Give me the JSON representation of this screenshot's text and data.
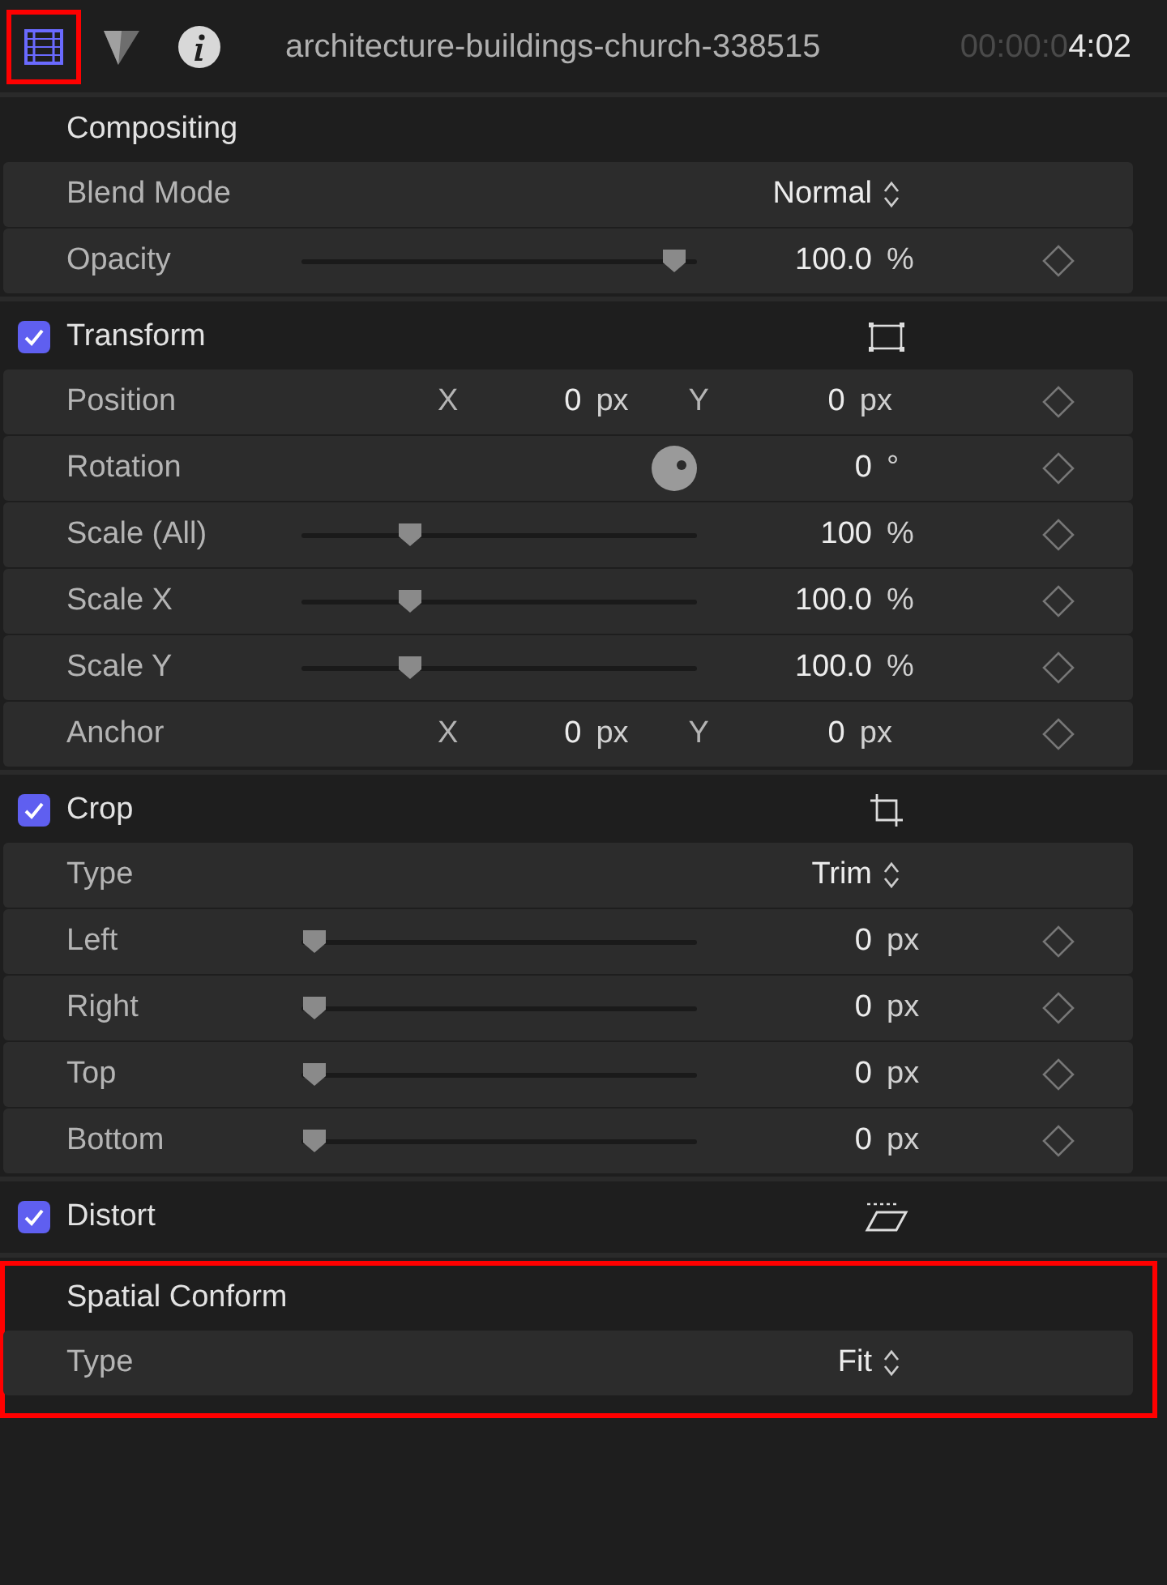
{
  "tabs": [
    {
      "kind": "video",
      "selected": true,
      "highlighted": true
    },
    {
      "kind": "color",
      "selected": false,
      "highlighted": false
    },
    {
      "kind": "info",
      "selected": false,
      "highlighted": false
    }
  ],
  "clip_name": "architecture-buildings-church-338515",
  "timecode": {
    "dim": "00:00:0",
    "bright": "4:02"
  },
  "sections": [
    {
      "title": "Compositing",
      "kind": "plain",
      "highlighted": false,
      "rows": [
        {
          "kind": "popup",
          "label": "Blend Mode",
          "value": "Normal"
        },
        {
          "kind": "slider",
          "label": "Opacity",
          "level": 0.975,
          "value": "100.0",
          "unit": "%"
        }
      ]
    },
    {
      "title": "Transform",
      "kind": "transform",
      "checked": true,
      "highlighted": false,
      "rows": [
        {
          "kind": "xy",
          "label": "Position",
          "x_label": "X",
          "x_value": "0",
          "x_unit": "px",
          "y_label": "Y",
          "y_value": "0",
          "y_unit": "px"
        },
        {
          "kind": "dial",
          "label": "Rotation",
          "value": "0",
          "unit": "°"
        },
        {
          "kind": "slider",
          "label": "Scale (All)",
          "level": 0.26,
          "value": "100",
          "unit": "%"
        },
        {
          "kind": "slider",
          "label": "Scale X",
          "level": 0.26,
          "value": "100.0",
          "unit": "%"
        },
        {
          "kind": "slider",
          "label": "Scale Y",
          "level": 0.26,
          "value": "100.0",
          "unit": "%"
        },
        {
          "kind": "xy",
          "label": "Anchor",
          "x_label": "X",
          "x_value": "0",
          "x_unit": "px",
          "y_label": "Y",
          "y_value": "0",
          "y_unit": "px"
        }
      ]
    },
    {
      "title": "Crop",
      "kind": "crop",
      "checked": true,
      "highlighted": false,
      "rows": [
        {
          "kind": "popup",
          "label": "Type",
          "value": "Trim"
        },
        {
          "kind": "slider",
          "label": "Left",
          "level": 0.0,
          "value": "0",
          "unit": "px"
        },
        {
          "kind": "slider",
          "label": "Right",
          "level": 0.0,
          "value": "0",
          "unit": "px"
        },
        {
          "kind": "slider",
          "label": "Top",
          "level": 0.0,
          "value": "0",
          "unit": "px"
        },
        {
          "kind": "slider",
          "label": "Bottom",
          "level": 0.0,
          "value": "0",
          "unit": "px"
        }
      ]
    },
    {
      "title": "Distort",
      "kind": "distort",
      "checked": true,
      "highlighted": false
    },
    {
      "title": "Spatial Conform",
      "kind": "plain",
      "highlighted": true,
      "rows": [
        {
          "kind": "popup",
          "label": "Type",
          "value": "Fit"
        }
      ]
    }
  ]
}
